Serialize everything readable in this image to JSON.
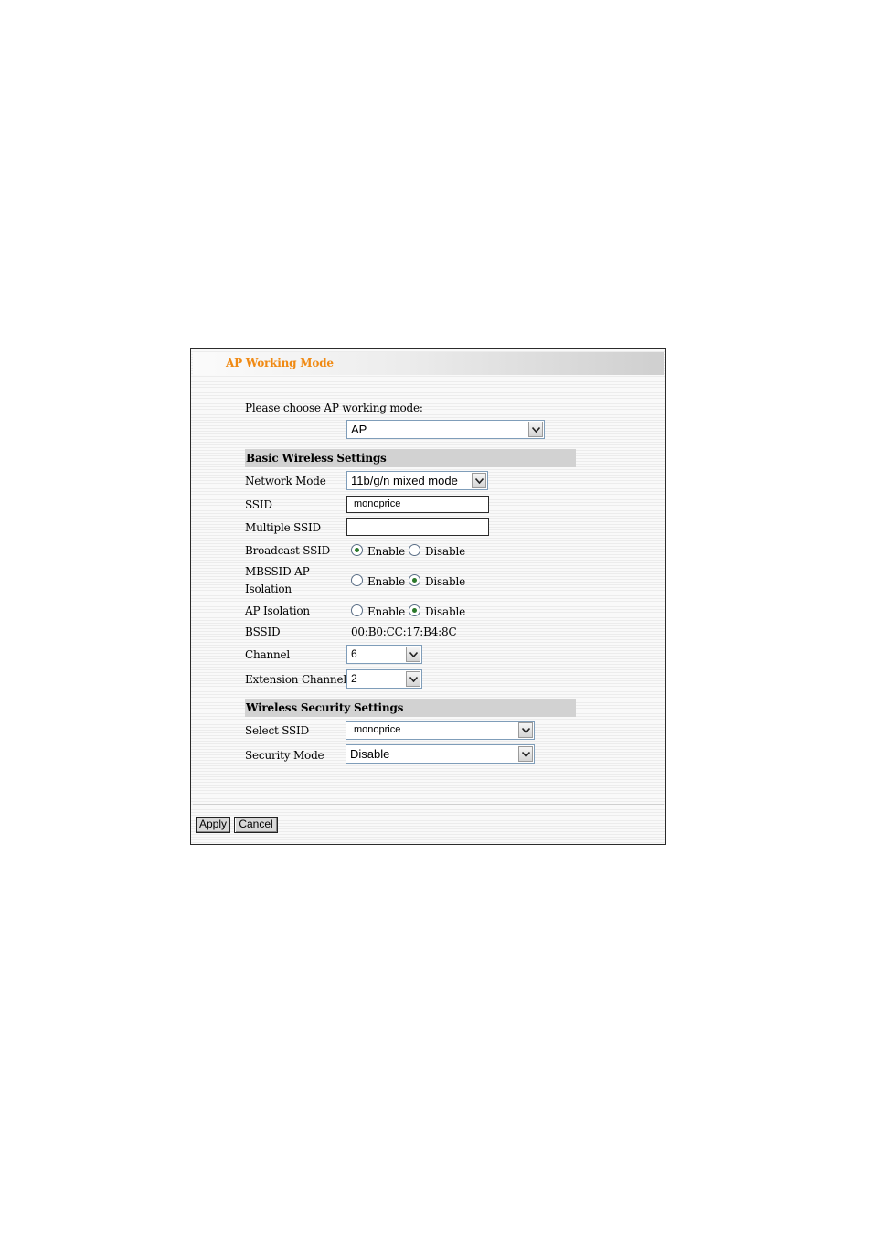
{
  "header": {
    "title": "AP Working Mode"
  },
  "mode": {
    "prompt": "Please choose AP working mode:",
    "value": "AP"
  },
  "basic": {
    "heading": "Basic Wireless Settings",
    "network_mode": {
      "label": "Network Mode",
      "value": "11b/g/n mixed mode"
    },
    "ssid": {
      "label": "SSID",
      "value": "monoprice"
    },
    "multiple_ssid": {
      "label": "Multiple SSID",
      "value": ""
    },
    "broadcast_ssid": {
      "label": "Broadcast SSID",
      "selected": "Enable"
    },
    "mbssid_isolation": {
      "label_line1": "MBSSID AP",
      "label_line2": "Isolation",
      "selected": "Disable"
    },
    "ap_isolation": {
      "label": "AP Isolation",
      "selected": "Disable"
    },
    "bssid": {
      "label": "BSSID",
      "value": "00:B0:CC:17:B4:8C"
    },
    "channel": {
      "label": "Channel",
      "value": "6"
    },
    "extension_channel": {
      "label": "Extension Channel",
      "value": "2"
    },
    "enable_label": "Enable",
    "disable_label": "Disable"
  },
  "security": {
    "heading": "Wireless Security Settings",
    "select_ssid": {
      "label": "Select SSID",
      "value": "monoprice"
    },
    "security_mode": {
      "label": "Security Mode",
      "value": "Disable"
    }
  },
  "buttons": {
    "apply": "Apply",
    "cancel": "Cancel"
  },
  "icons": {
    "dropdown": "chevron-down-icon",
    "radio": "radio-icon"
  }
}
